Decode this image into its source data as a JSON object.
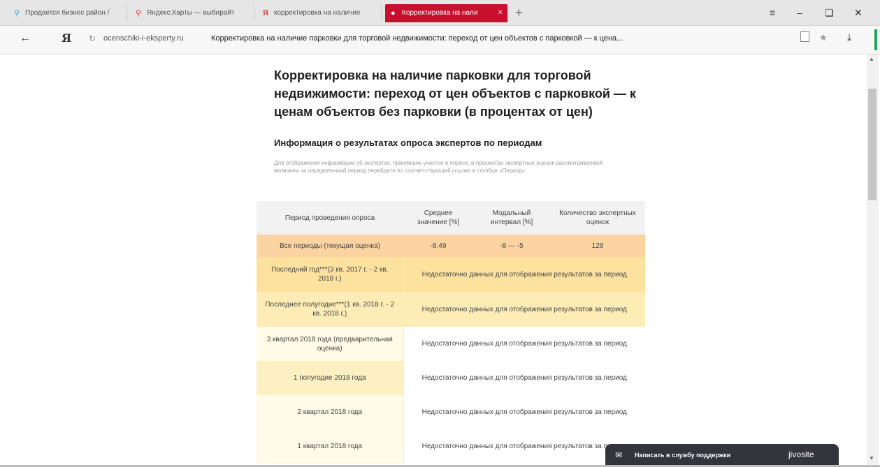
{
  "browser": {
    "tabs": [
      {
        "label": "Продается бизнес район /",
        "icon": "map-pin-icon",
        "icon_color": "#3ea0d9"
      },
      {
        "label": "Яндекс.Карты — выбирайт",
        "icon": "map-pin-icon",
        "icon_color": "#e53935"
      },
      {
        "label": "корректировка на наличие",
        "icon": "yandex-icon",
        "icon_color": "#e53935"
      },
      {
        "label": "Корректировка на нали",
        "icon": "dot-icon",
        "icon_color": "#ffffff",
        "active": true
      }
    ],
    "new_tab_icon": "plus-icon",
    "tab_close_icon": "close-icon",
    "window_controls": [
      "menu-icon",
      "minimize-icon",
      "restore-icon",
      "close-icon"
    ],
    "address": {
      "back_icon": "arrow-left-icon",
      "logo": "Я",
      "reload_icon": "reload-icon",
      "domain": "ocenschiki-i-eksperty.ru",
      "page_title": "Корректировка на наличие парковки для торговой недвижимости: переход от цен объектов с парковкой — к цена..."
    },
    "accent_color": "#c8102e"
  },
  "page": {
    "title": "Корректировка на наличие парковки для торговой недвижимости: переход от цен объектов с парковкой — к ценам объектов без парковки (в процентах от цен)",
    "subtitle": "Информация о результатах опроса экспертов по периодам",
    "info_text": "Для отображения информации об экспертах, принявших участие в опросе, и просмотра экспертных оценок рассматриваемой величины за определенный период перейдите по соответствующей ссылке в столбце «Период»"
  },
  "table": {
    "headers": [
      "Период проведения опроса",
      "Среднее значение [%]",
      "Модальный интервал [%]",
      "Количество экспертных оценок"
    ],
    "rows": [
      {
        "period": "Все периоды (текущая оценка)",
        "mean": "-8.49",
        "modal": "-8 — -5",
        "count": "128"
      },
      {
        "period": "Последний год***(3 кв. 2017 г. - 2 кв. 2018 г.)",
        "message": "Недостаточно данных для отображения результатов за период"
      },
      {
        "period": "Последнее полугодие***(1 кв. 2018 г. - 2 кв. 2018 г.)",
        "message": "Недостаточно данных для отображения результатов за период"
      },
      {
        "period": "3 квартал 2018 года (предварительная оценка)",
        "message": "Недостаточно данных для отображения результатов за период"
      },
      {
        "period": "1 полугодие 2018 года",
        "message": "Недостаточно данных для отображения результатов за период"
      },
      {
        "period": "2 квартал 2018 года",
        "message": "Недостаточно данных для отображения результатов за период"
      },
      {
        "period": "1 квартал 2018 года",
        "message": "Недостаточно данных для отображения результатов за период"
      }
    ]
  },
  "chat": {
    "label": "Написать в службу поддержки",
    "brand": "jivosite",
    "icon": "mail-icon"
  }
}
